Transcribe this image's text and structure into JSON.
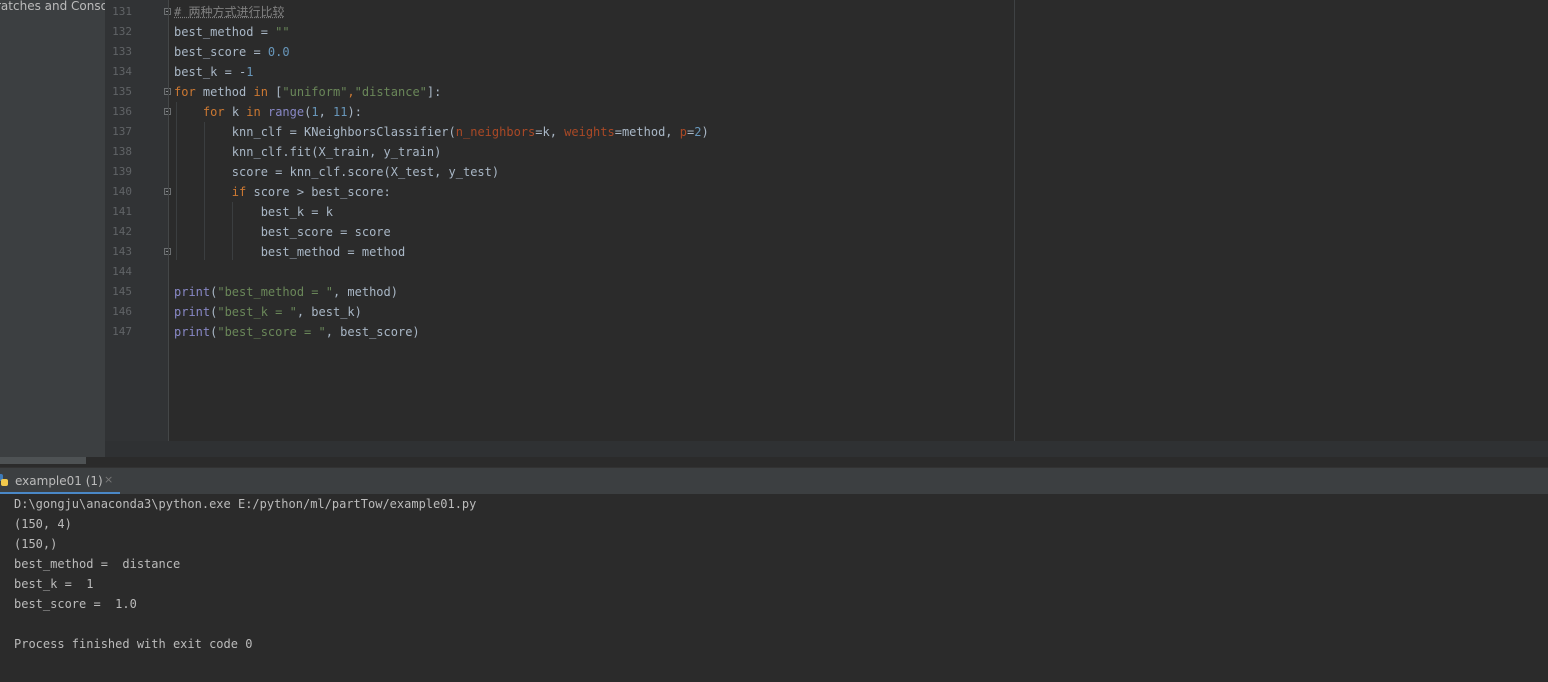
{
  "sidebar": {
    "label": "ratches and Conso"
  },
  "editor": {
    "lines": [
      {
        "n": "131",
        "html": "<span class=\"cm\"># 两种方式进行比较</span>"
      },
      {
        "n": "132",
        "html": "best_method = <span class=\"str\">\"\"</span>"
      },
      {
        "n": "133",
        "html": "best_score = <span class=\"num\">0.0</span>"
      },
      {
        "n": "134",
        "html": "best_k = -<span class=\"num\">1</span>"
      },
      {
        "n": "135",
        "html": "<span class=\"kw\">for</span> method <span class=\"kw\">in</span> [<span class=\"str\">\"uniform\"</span><span class=\"kw\">,</span><span class=\"str\">\"distance\"</span>]:"
      },
      {
        "n": "136",
        "html": "    <span class=\"kw\">for</span> k <span class=\"kw\">in</span> <span class=\"fn\">range</span>(<span class=\"num\">1</span>, <span class=\"num\">11</span>):"
      },
      {
        "n": "137",
        "html": "        knn_clf = KNeighborsClassifier(<span class=\"prm\">n_neighbors</span>=k, <span class=\"prm\">weights</span>=method, <span class=\"prm\">p</span>=<span class=\"num\">2</span>)"
      },
      {
        "n": "138",
        "html": "        knn_clf.fit(X_train, y_train)"
      },
      {
        "n": "139",
        "html": "        score = knn_clf.score(X_test, y_test)"
      },
      {
        "n": "140",
        "html": "        <span class=\"kw\">if</span> score > best_score:"
      },
      {
        "n": "141",
        "html": "            best_k = k"
      },
      {
        "n": "142",
        "html": "            best_score = score"
      },
      {
        "n": "143",
        "html": "            best_method = method"
      },
      {
        "n": "144",
        "html": ""
      },
      {
        "n": "145",
        "html": "<span class=\"fn\">print</span>(<span class=\"str\">\"best_method = \"</span>, method)"
      },
      {
        "n": "146",
        "html": "<span class=\"fn\">print</span>(<span class=\"str\">\"best_k = \"</span>, best_k)"
      },
      {
        "n": "147",
        "html": "<span class=\"fn\">print</span>(<span class=\"str\">\"best_score = \"</span>, best_score)"
      }
    ]
  },
  "run_panel": {
    "tab_label": "example01 (1)",
    "close_glyph": "×",
    "output": [
      "D:\\gongju\\anaconda3\\python.exe E:/python/ml/partTow/example01.py",
      "(150, 4)",
      "(150,)",
      "best_method =  distance",
      "best_k =  1",
      "best_score =  1.0",
      "",
      "Process finished with exit code 0"
    ]
  },
  "colors": {
    "editor_bg": "#2b2b2b",
    "keyword": "#cc7832",
    "string": "#6a8759",
    "number": "#6897bb",
    "builtin": "#8888c6",
    "param": "#aa4926",
    "accent": "#4a88c7"
  },
  "icons": {
    "run_tab_icon": "python-icon",
    "close": "close-icon"
  }
}
